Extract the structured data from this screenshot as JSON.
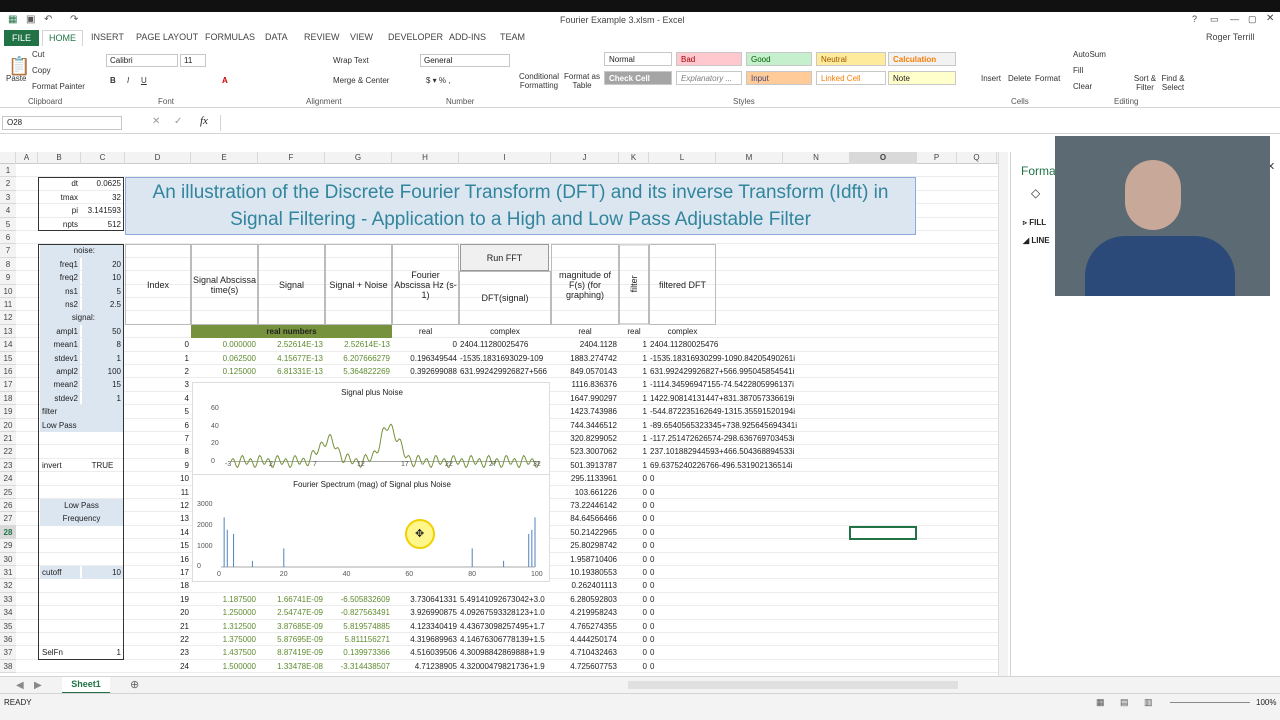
{
  "window_title": "Fourier Example 3.xlsm - Excel",
  "user": "Roger Terrill",
  "tabs": [
    "FILE",
    "HOME",
    "INSERT",
    "PAGE LAYOUT",
    "FORMULAS",
    "DATA",
    "REVIEW",
    "VIEW",
    "DEVELOPER",
    "ADD-INS",
    "TEAM"
  ],
  "ribbon": {
    "paste": "Paste",
    "cut": "Cut",
    "copy": "Copy",
    "format_painter": "Format Painter",
    "font_name": "Calibri",
    "font_size": "11",
    "wrap": "Wrap Text",
    "merge": "Merge & Center",
    "number_format": "General",
    "cond": "Conditional Formatting",
    "fmt_table": "Format as Table",
    "insert": "Insert",
    "delete": "Delete",
    "format": "Format",
    "autosum": "AutoSum",
    "fill": "Fill",
    "clear": "Clear",
    "sort": "Sort & Filter",
    "find": "Find & Select",
    "groups": [
      "Clipboard",
      "Font",
      "Alignment",
      "Number",
      "Styles",
      "Cells",
      "Editing"
    ],
    "styles": [
      "Normal",
      "Bad",
      "Good",
      "Neutral",
      "Calculation",
      "Check Cell",
      "Explanatory ...",
      "Input",
      "Linked Cell",
      "Note"
    ]
  },
  "namebox": "O28",
  "fx": "fx",
  "columns": [
    "A",
    "B",
    "C",
    "D",
    "E",
    "F",
    "G",
    "H",
    "I",
    "J",
    "K",
    "L",
    "M",
    "N",
    "O",
    "P",
    "Q"
  ],
  "title": "An illustration of the Discrete Fourier Transform (DFT) and its inverse Transform (Idft) in Signal Filtering - Application to a High and Low Pass Adjustable Filter",
  "params": [
    [
      "dt",
      "0.0625"
    ],
    [
      "tmax",
      "32"
    ],
    [
      "pi",
      "3.141593"
    ],
    [
      "npts",
      "512"
    ]
  ],
  "noise_label": "noise:",
  "noise": [
    [
      "freq1",
      "20"
    ],
    [
      "freq2",
      "10"
    ],
    [
      "ns1",
      "5"
    ],
    [
      "ns2",
      "2.5"
    ]
  ],
  "signal_label": "signal:",
  "signal": [
    [
      "ampl1",
      "50"
    ],
    [
      "mean1",
      "8"
    ],
    [
      "stdev1",
      "1"
    ],
    [
      "ampl2",
      "100"
    ],
    [
      "mean2",
      "15"
    ],
    [
      "stdev2",
      "1"
    ]
  ],
  "filter_label": "filter",
  "lowpass_label": "Low Pass",
  "invert_label": "invert",
  "invert_val": "TRUE",
  "lowpass2": "Low Pass",
  "frequency": "Frequency",
  "cutoff_label": "cutoff",
  "cutoff_val": "10",
  "selfn_label": "SelFn",
  "selfn_val": "1",
  "headers": {
    "index": "Index",
    "abscissa": "Signal Abscissa time(s)",
    "signal": "Signal",
    "signal_noise": "Signal + Noise",
    "fourier": "Fourier Abscissa Hz (s-1)",
    "run": "Run FFT",
    "dft": "DFT(signal)",
    "mag": "magnitude of F(s) (for graphing)",
    "filter": "filter",
    "filtered": "filtered DFT",
    "real_numbers": "real numbers",
    "real": "real",
    "complex": "complex",
    "real2": "real",
    "real3": "real",
    "complex2": "complex"
  },
  "rows": [
    [
      "0",
      "0.000000",
      "2.52614E-13",
      "2.52614E-13",
      "0",
      "2404.11280025476",
      "2404.1128",
      "1",
      "2404.11280025476"
    ],
    [
      "1",
      "0.062500",
      "4.15677E-13",
      "6.207666279",
      "0.196349544",
      "-1535.1831693029-109",
      "1883.274742",
      "1",
      "-1535.18316930299-1090.84205490261i"
    ],
    [
      "2",
      "0.125000",
      "6.81331E-13",
      "5.364822269",
      "0.392699088",
      "631.992429926827+566",
      "849.0570143",
      "1",
      "631.992429926827+566.995045854541i"
    ],
    [
      "3",
      "",
      "",
      "",
      "",
      "",
      "1116.836376",
      "1",
      "-1114.34596947155-74.5422805996137i"
    ],
    [
      "4",
      "",
      "",
      "",
      "",
      "",
      "1647.990297",
      "1",
      "1422.90814131447+831.387057336619i"
    ],
    [
      "5",
      "",
      "",
      "",
      "",
      "",
      "1423.743986",
      "1",
      "-544.872235162649-1315.35591520194i"
    ],
    [
      "6",
      "",
      "",
      "",
      "",
      "",
      "744.3446512",
      "1",
      "-89.6540565323345+738.925645694341i"
    ],
    [
      "7",
      "",
      "",
      "",
      "",
      "",
      "320.8299052",
      "1",
      "-117.251472626574-298.636769703453i"
    ],
    [
      "8",
      "",
      "",
      "",
      "",
      "",
      "523.3007062",
      "1",
      "237.101882944593+466.504368894533i"
    ],
    [
      "9",
      "",
      "",
      "",
      "",
      "",
      "501.3913787",
      "1",
      "69.6375240226766-496.531902136514i"
    ],
    [
      "10",
      "",
      "",
      "",
      "",
      "",
      "295.1133961",
      "0",
      "0"
    ],
    [
      "11",
      "",
      "",
      "",
      "",
      "",
      "103.661226",
      "0",
      "0"
    ],
    [
      "12",
      "",
      "",
      "",
      "",
      "",
      "73.22446142",
      "0",
      "0"
    ],
    [
      "13",
      "",
      "",
      "",
      "",
      "",
      "84.64566466",
      "0",
      "0"
    ],
    [
      "14",
      "",
      "",
      "",
      "",
      "",
      "50.21422965",
      "0",
      "0"
    ],
    [
      "15",
      "",
      "",
      "",
      "",
      "",
      "25.80298742",
      "0",
      "0"
    ],
    [
      "16",
      "",
      "",
      "",
      "",
      "",
      "1.958710406",
      "0",
      "0"
    ],
    [
      "17",
      "",
      "",
      "",
      "",
      "",
      "10.19380553",
      "0",
      "0"
    ],
    [
      "18",
      "",
      "",
      "",
      "",
      "",
      "0.262401113",
      "0",
      "0"
    ],
    [
      "19",
      "1.187500",
      "1.66741E-09",
      "-6.505832609",
      "3.730641331",
      "5.49141092673042+3.0",
      "6.280592803",
      "0",
      "0"
    ],
    [
      "20",
      "1.250000",
      "2.54747E-09",
      "-0.827563491",
      "3.926990875",
      "4.09267593328123+1.0",
      "4.219958243",
      "0",
      "0"
    ],
    [
      "21",
      "1.312500",
      "3.87685E-09",
      "5.819574885",
      "4.123340419",
      "4.43673098257495+1.7",
      "4.765274355",
      "0",
      "0"
    ],
    [
      "22",
      "1.375000",
      "5.87695E-09",
      "5.811156271",
      "4.319689963",
      "4.14676306778139+1.5",
      "4.444250174",
      "0",
      "0"
    ],
    [
      "23",
      "1.437500",
      "8.87419E-09",
      "0.139973366",
      "4.516039506",
      "4.30098842869888+1.9",
      "4.710432463",
      "0",
      "0"
    ],
    [
      "24",
      "1.500000",
      "1.33478E-08",
      "-3.314438507",
      "4.71238905",
      "4.32000479821736+1.9",
      "4.725607753",
      "0",
      "0"
    ]
  ],
  "chart1": {
    "title": "Signal plus Noise",
    "yticks": [
      "60",
      "40",
      "20",
      "0",
      "-20"
    ],
    "xticks": [
      "-3",
      "2",
      "7",
      "12",
      "17",
      "22",
      "27",
      "32"
    ]
  },
  "chart2": {
    "title": "Fourier Spectrum (mag) of Signal plus Noise",
    "yticks": [
      "3000",
      "2000",
      "1000",
      "0"
    ],
    "xticks": [
      "0",
      "20",
      "40",
      "60",
      "80",
      "100"
    ]
  },
  "pane": {
    "title": "Forma",
    "fill": "FILL",
    "line": "LINE"
  },
  "sheet": "Sheet1",
  "status": "READY",
  "zoom": "100%"
}
